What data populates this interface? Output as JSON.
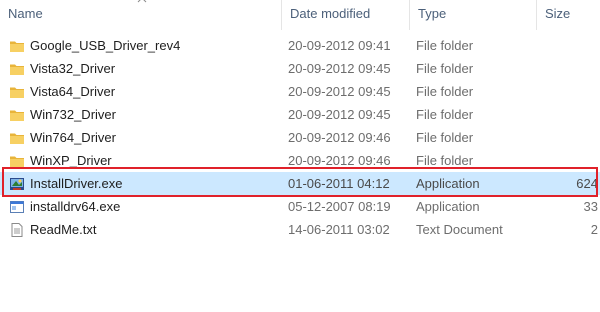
{
  "header": {
    "name": "Name",
    "date_modified": "Date modified",
    "type": "Type",
    "size": "Size"
  },
  "files": [
    {
      "name": "Google_USB_Driver_rev4",
      "date": "20-09-2012 09:41",
      "type": "File folder",
      "size": "",
      "icon": "folder-icon"
    },
    {
      "name": "Vista32_Driver",
      "date": "20-09-2012 09:45",
      "type": "File folder",
      "size": "",
      "icon": "folder-icon"
    },
    {
      "name": "Vista64_Driver",
      "date": "20-09-2012 09:45",
      "type": "File folder",
      "size": "",
      "icon": "folder-icon"
    },
    {
      "name": "Win732_Driver",
      "date": "20-09-2012 09:45",
      "type": "File folder",
      "size": "",
      "icon": "folder-icon"
    },
    {
      "name": "Win764_Driver",
      "date": "20-09-2012 09:46",
      "type": "File folder",
      "size": "",
      "icon": "folder-icon"
    },
    {
      "name": "WinXP_Driver",
      "date": "20-09-2012 09:46",
      "type": "File folder",
      "size": "",
      "icon": "folder-icon"
    },
    {
      "name": "InstallDriver.exe",
      "date": "01-06-2011 04:12",
      "type": "Application",
      "size": "624",
      "icon": "installer-app-icon"
    },
    {
      "name": "installdrv64.exe",
      "date": "05-12-2007 08:19",
      "type": "Application",
      "size": "33",
      "icon": "application-icon"
    },
    {
      "name": "ReadMe.txt",
      "date": "14-06-2011 03:02",
      "type": "Text Document",
      "size": "2",
      "icon": "text-document-icon"
    }
  ],
  "selected_index": 6,
  "colors": {
    "selection": "#cce8ff",
    "highlight_border": "#e0212a",
    "folder": "#f4c542",
    "header_text": "#4c607a"
  }
}
